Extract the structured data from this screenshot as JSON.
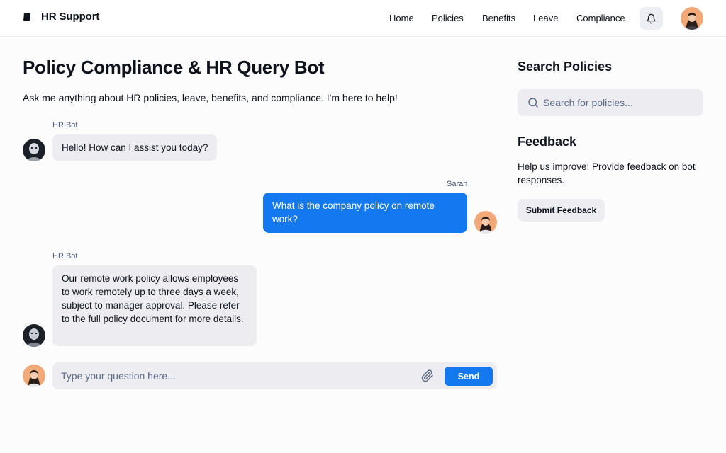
{
  "header": {
    "brand_title": "HR Support",
    "nav": [
      "Home",
      "Policies",
      "Benefits",
      "Leave",
      "Compliance"
    ],
    "icons": {
      "logo": "book-icon",
      "bell": "bell-icon"
    }
  },
  "main": {
    "title": "Policy Compliance & HR Query Bot",
    "subtitle": "Ask me anything about HR policies, leave, benefits, and compliance. I'm here to help!"
  },
  "chat": {
    "messages": [
      {
        "sender": "HR Bot",
        "role": "bot",
        "text": "Hello! How can I assist you today?"
      },
      {
        "sender": "Sarah",
        "role": "user",
        "text": "What is the company policy on remote work?"
      },
      {
        "sender": "HR Bot",
        "role": "bot",
        "text": "Our remote work policy allows employees to work remotely up to three days a week, subject to manager approval. Please refer to the full policy document for more details."
      }
    ],
    "composer": {
      "placeholder": "Type your question here...",
      "send_label": "Send",
      "attach_icon": "paperclip-icon"
    }
  },
  "sidebar": {
    "search_heading": "Search Policies",
    "search_placeholder": "Search for policies...",
    "feedback_heading": "Feedback",
    "feedback_text": "Help us improve! Provide feedback on bot responses.",
    "feedback_button": "Submit Feedback"
  },
  "colors": {
    "accent": "#1478ee",
    "bubble_bot": "#ececf1",
    "text": "#0d121b",
    "muted": "#4b5a7a"
  }
}
